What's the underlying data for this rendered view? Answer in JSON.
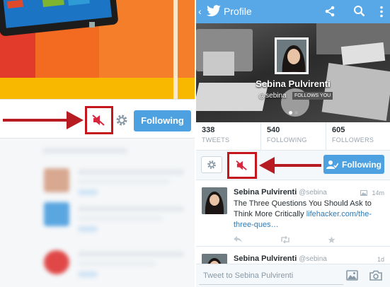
{
  "left": {
    "following_label": "Following"
  },
  "right": {
    "title": "Profile",
    "profile": {
      "name": "Sebina Pulvirenti",
      "handle": "@sebina",
      "follows_you": "FOLLOWS YOU"
    },
    "stats": [
      {
        "value": "338",
        "label": "TWEETS"
      },
      {
        "value": "540",
        "label": "FOLLOWING"
      },
      {
        "value": "605",
        "label": "FOLLOWERS"
      }
    ],
    "following_label": "Following",
    "tweets": [
      {
        "name": "Sebina Pulvirenti",
        "handle": "@sebina",
        "time": "14m",
        "text": "The Three Questions You Should Ask to Think More Critically ",
        "link": "lifehacker.com/the-three-ques…"
      },
      {
        "name": "Sebina Pulvirenti",
        "handle": "@sebina",
        "time": "1d"
      }
    ],
    "composer_placeholder": "Tweet to Sebina Pulvirenti"
  },
  "colors": {
    "twitter_blue": "#58a8e8",
    "button_blue": "#4ea1e0",
    "highlight_red": "#c4161c",
    "mute_red": "#d7263d"
  },
  "icons": [
    "back-icon",
    "twitter-bird-icon",
    "share-icon",
    "search-icon",
    "overflow-menu-icon",
    "gear-icon",
    "mute-icon",
    "add-user-icon",
    "reply-icon",
    "retweet-icon",
    "favorite-icon",
    "photo-icon",
    "camera-icon",
    "image-card-icon"
  ]
}
